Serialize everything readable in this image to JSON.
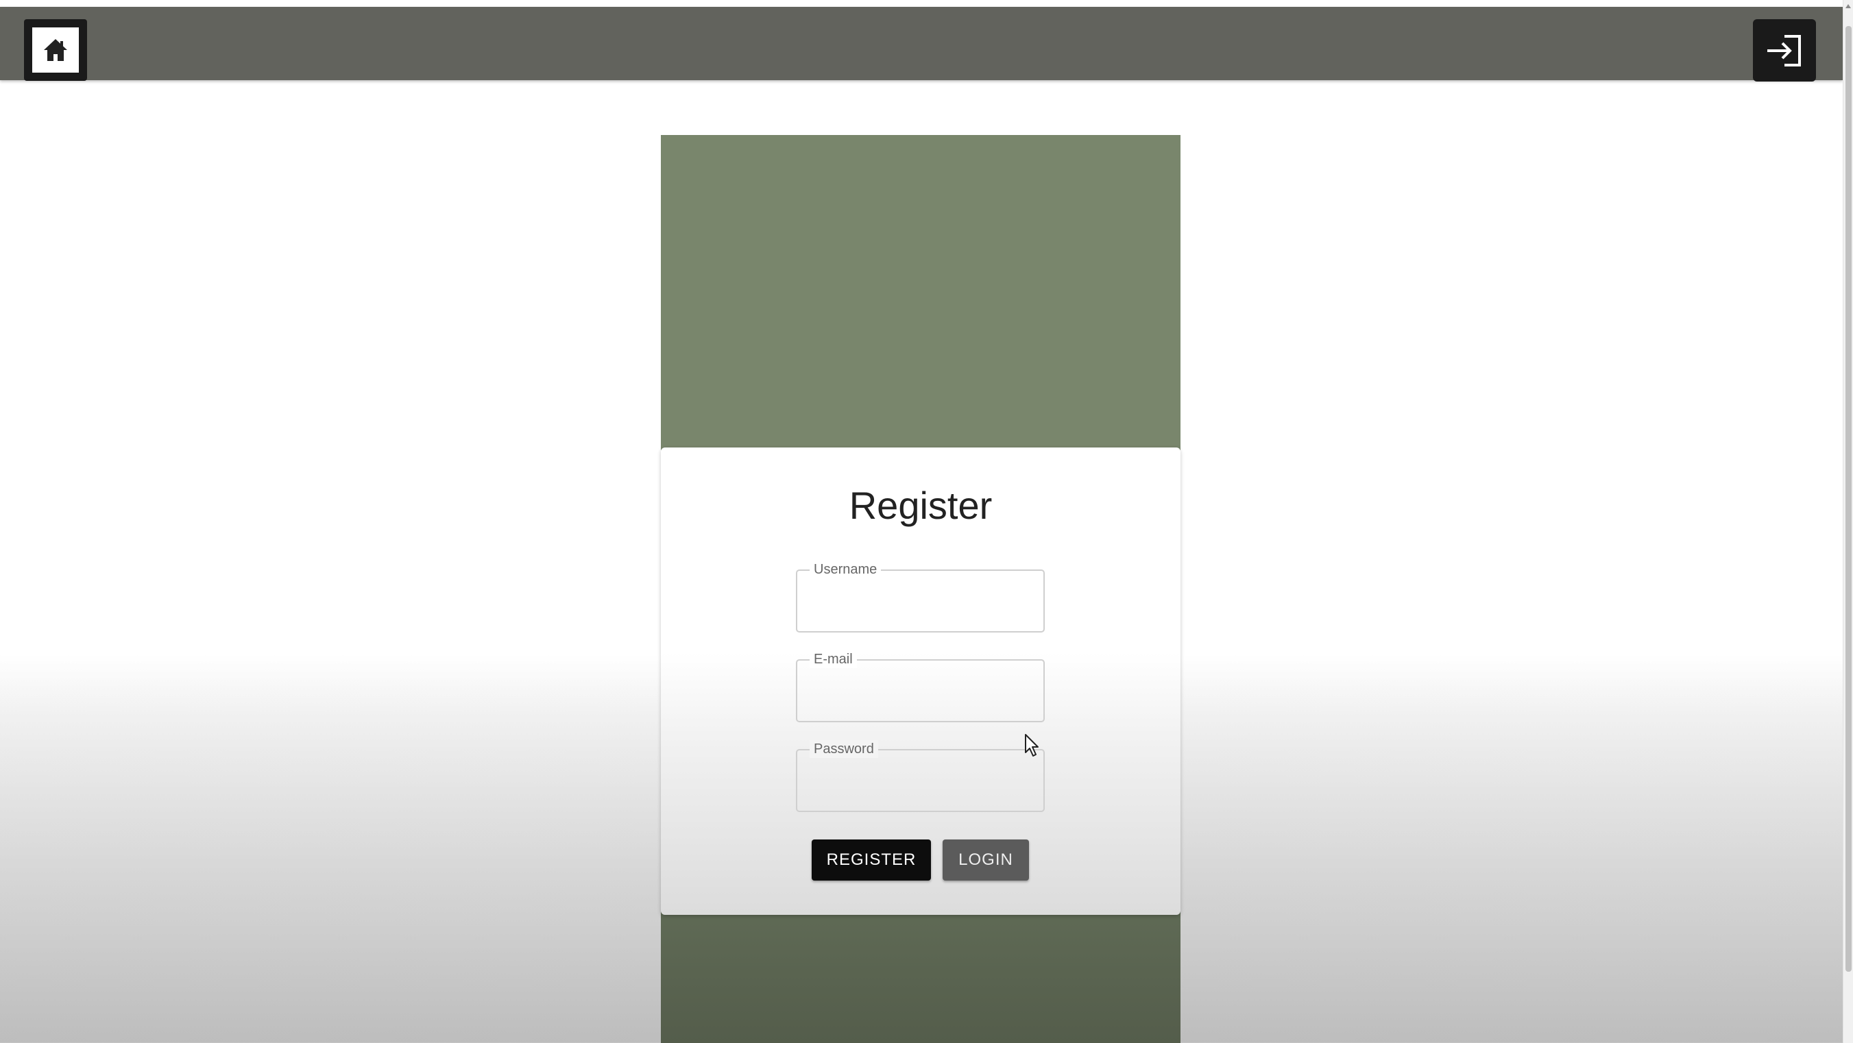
{
  "app_bar": {
    "home_icon": "home-icon",
    "login_icon": "login-arrow-icon",
    "background_color": "#62635d"
  },
  "hero": {
    "color": "#79866c"
  },
  "form": {
    "title": "Register",
    "username": {
      "label": "Username",
      "value": ""
    },
    "email": {
      "label": "E-mail",
      "value": ""
    },
    "password": {
      "label": "Password",
      "value": ""
    },
    "register_button": "REGISTER",
    "login_button": "LOGIN"
  }
}
